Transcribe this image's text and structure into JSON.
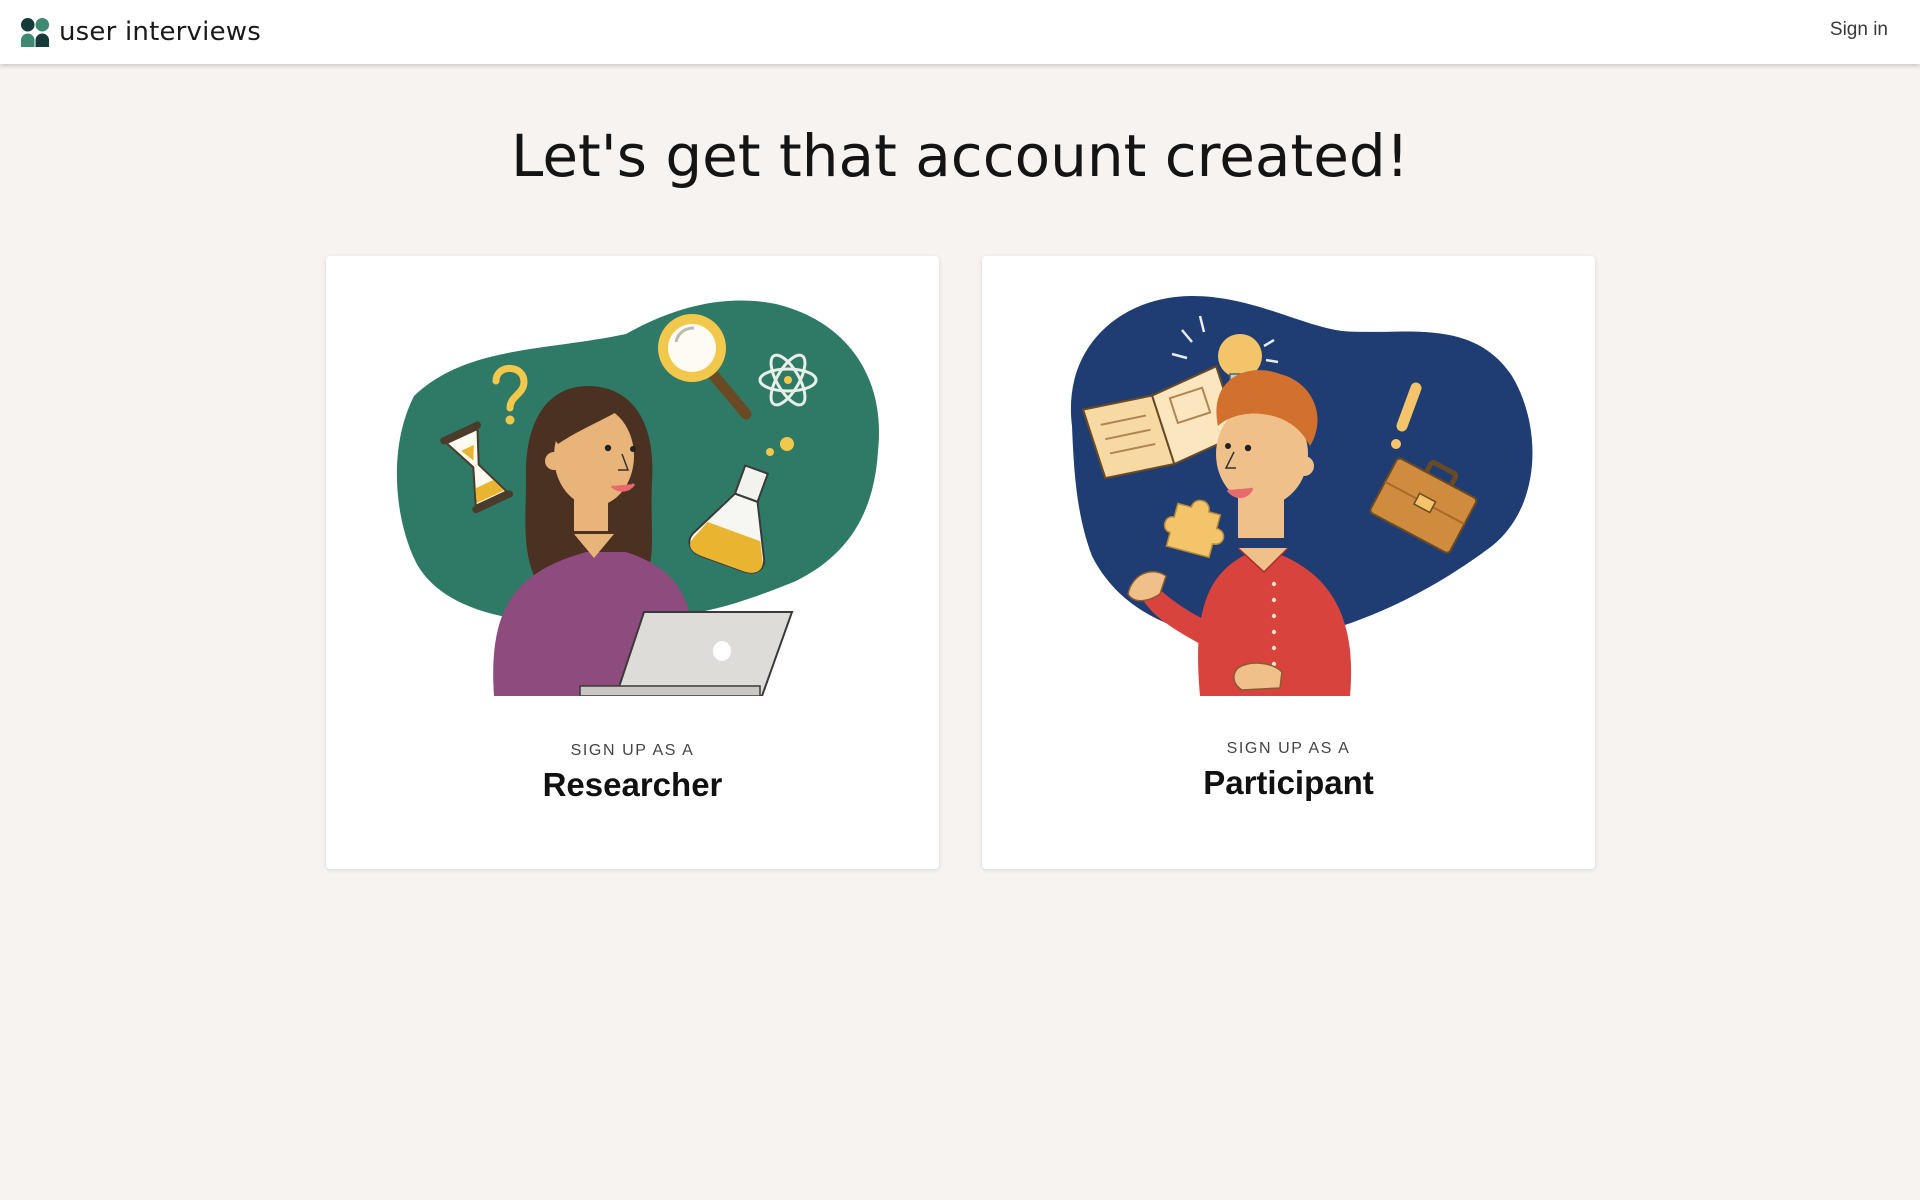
{
  "header": {
    "brand": "user interviews",
    "sign_in": "Sign in"
  },
  "main": {
    "title": "Let's get that account created!",
    "cards": [
      {
        "subtitle": "SIGN UP AS A",
        "role": "Researcher",
        "blob_color": "#2e7a66",
        "icons": [
          "question-mark-icon",
          "hourglass-icon",
          "magnifying-glass-icon",
          "atom-icon",
          "flask-icon",
          "laptop-icon"
        ]
      },
      {
        "subtitle": "SIGN UP AS A",
        "role": "Participant",
        "blob_color": "#1f3d73",
        "icons": [
          "lightbulb-icon",
          "book-icon",
          "puzzle-piece-icon",
          "exclamation-icon",
          "briefcase-icon"
        ]
      }
    ]
  },
  "colors": {
    "page_background": "#f6f3f0",
    "header_background": "#ffffff",
    "logo_dark": "#163b3a",
    "logo_green": "#3d8a72"
  }
}
